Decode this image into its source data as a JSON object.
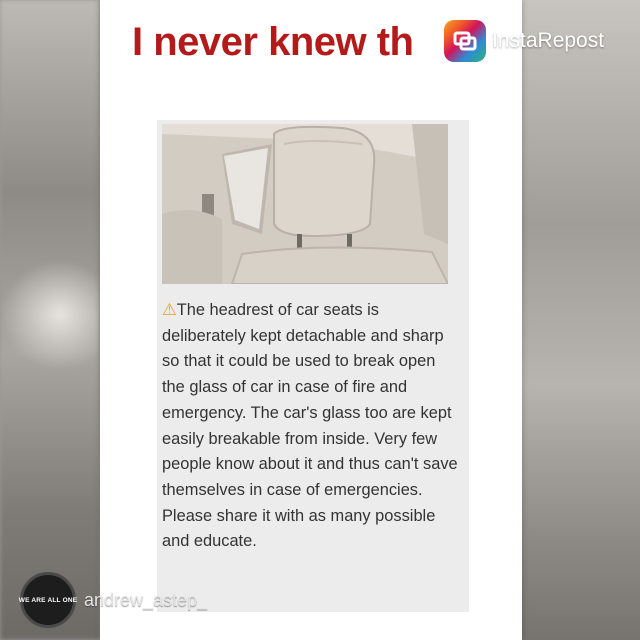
{
  "post": {
    "headline": "I never knew th",
    "warning_icon": "warning-triangle-icon",
    "paragraph_1": "The headrest of car seats is deliberately kept detachable and sharp so that it could be used to break open the glass of car in case of fire and emergency. The car's glass too are kept easily breakable from inside. Very few people know about it and thus can't save themselves in case of emergencies.",
    "paragraph_2": "Please share it with as many possible and educate.",
    "headline_color": "#b31b1b"
  },
  "watermark": {
    "app_name": "InstaRepost",
    "icon": "repost-arrows-icon"
  },
  "attribution": {
    "username": "andrew_astep_",
    "avatar_text": "WE ARE ALL ONE"
  }
}
